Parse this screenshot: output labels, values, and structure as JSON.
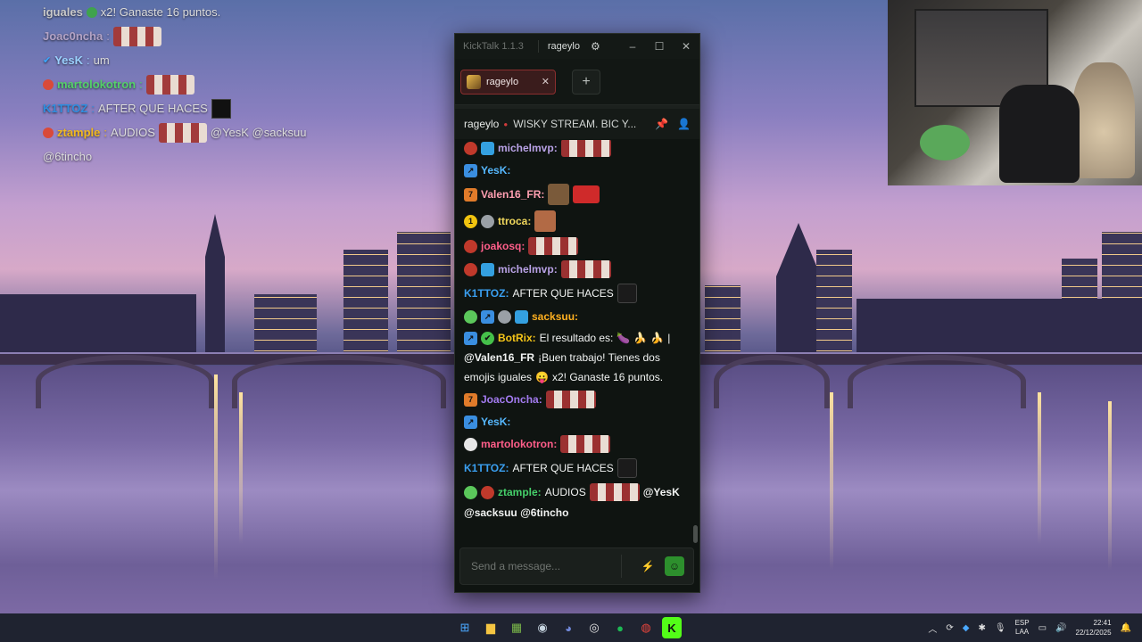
{
  "overlay_chat": {
    "lines": [
      {
        "name": "iguales",
        "color": "#c9c9c9",
        "text": "x2! Ganaste 16 puntos."
      },
      {
        "name": "Joac0ncha",
        "color": "#b3a3c6",
        "text": ""
      },
      {
        "name": "YesK",
        "color": "#9bd1ff",
        "text": "um"
      },
      {
        "name": "martolokotron",
        "color": "#55d06a",
        "text": ""
      },
      {
        "name": "K1TTOZ",
        "color": "#2f8ee0",
        "text": "AFTER QUE HACES"
      },
      {
        "name": "ztample",
        "color": "#f1b91e",
        "text": "AUDIOS"
      },
      {
        "name": "",
        "color": "#dcdcdc",
        "text": "@6tincho"
      }
    ],
    "mentions": "@YesK @sacksuu"
  },
  "kicktalk": {
    "app_title": "KickTalk 1.1.3",
    "username": "rageylo",
    "gear_icon": "⚙",
    "win_buttons": {
      "minimize": "–",
      "maximize": "☐",
      "close": "✕"
    },
    "tab": {
      "label": "rageylo",
      "close": "✕"
    },
    "add_tab": "+",
    "channel": {
      "name": "rageylo",
      "title": "WISKY STREAM. BIC Y..."
    },
    "messages": [
      {
        "user": "michelmvp:",
        "color": "#b9a2e6",
        "text": ""
      },
      {
        "user": "YesK:",
        "color": "#56b8ff",
        "text": ""
      },
      {
        "user": "Valen16_FR:",
        "color": "#ff9fb1",
        "text": ""
      },
      {
        "user": "ttroca:",
        "color": "#f0d75c",
        "text": ""
      },
      {
        "user": "joakosq:",
        "color": "#ff5e8a",
        "text": ""
      },
      {
        "user": "michelmvp:",
        "color": "#b9a2e6",
        "text": ""
      },
      {
        "user": "K1TTOZ:",
        "color": "#3a9ff0",
        "text": "AFTER QUE HACES"
      },
      {
        "user": "sacksuu:",
        "color": "#ffb020",
        "text": ""
      },
      {
        "user": "BotRix:",
        "color": "#f5c518",
        "text": "El resultado es:",
        "line2_mention": "@Valen16_FR",
        "line2_text": "¡Buen trabajo! Tienes dos",
        "line3_text": "emojis iguales",
        "line3_tail": "x2! Ganaste 16 puntos."
      },
      {
        "user": "JoacOncha:",
        "color": "#a37bf0",
        "text": ""
      },
      {
        "user": "YesK:",
        "color": "#56b8ff",
        "text": ""
      },
      {
        "user": "martolokotron:",
        "color": "#ff5e8a",
        "text": ""
      },
      {
        "user": "K1TTOZ:",
        "color": "#3a9ff0",
        "text": "AFTER QUE HACES"
      },
      {
        "user": "ztample:",
        "color": "#45d06a",
        "text": "AUDIOS",
        "mention1": "@YesK",
        "line2": "@sacksuu @6tincho"
      }
    ],
    "input_placeholder": "Send a message...",
    "kick_icon": "⚡",
    "emote_icon": "☺"
  },
  "taskbar": {
    "icons": [
      "windows-start-icon",
      "file-explorer-icon",
      "minecraft-icon",
      "steam-icon",
      "discord-icon",
      "obs-icon",
      "spotify-icon",
      "chrome-icon",
      "kick-icon"
    ],
    "lang_top": "ESP",
    "lang_bottom": "LAA",
    "time": "22:41",
    "date": "22/12/2025"
  },
  "colors": {
    "kick_green": "#53fc18",
    "tab_border": "#8a2e2e",
    "app_bg": "#0f1411"
  }
}
